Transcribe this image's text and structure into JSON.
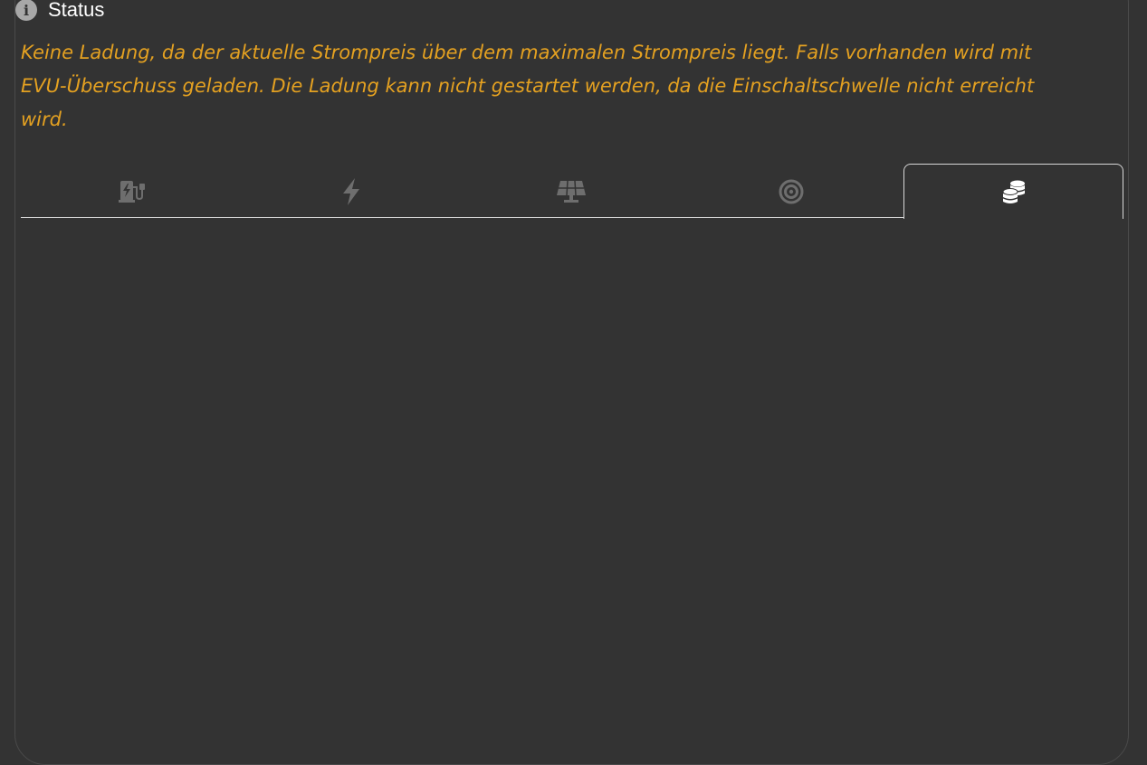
{
  "status": {
    "icon": "info-icon",
    "title": "Status",
    "message": "Keine Ladung, da der aktuelle Strompreis über dem maximalen Strompreis liegt. Falls vorhanden wird mit EVU-Überschuss geladen. Die Ladung kann nicht gestartet werden, da die Einschaltschwelle nicht erreicht wird.",
    "message_color": "#e4a121"
  },
  "tabs": [
    {
      "icon": "charging-station-icon",
      "active": false
    },
    {
      "icon": "bolt-icon",
      "active": false
    },
    {
      "icon": "solar-panel-icon",
      "active": false
    },
    {
      "icon": "target-icon",
      "active": false
    },
    {
      "icon": "coins-icon",
      "active": true
    }
  ],
  "colors": {
    "background": "#333333",
    "inactive_icon": "#6e6e6e",
    "active_icon": "#ffffff"
  }
}
